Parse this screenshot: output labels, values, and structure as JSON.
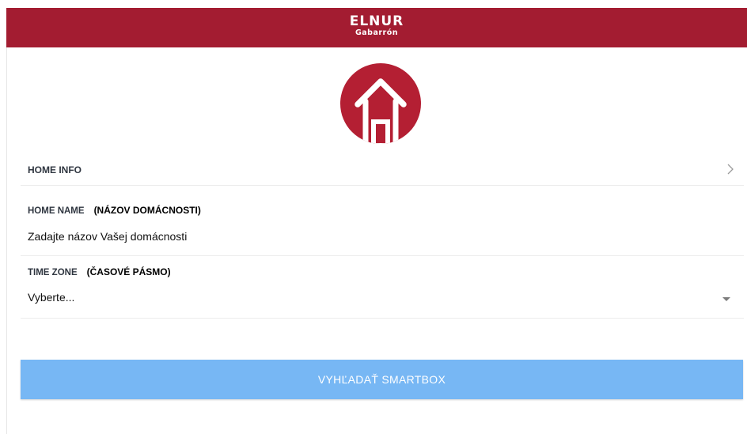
{
  "header": {
    "brand_top": "ELNUR",
    "brand_bottom": "Gabarrón",
    "color": "#a31c31"
  },
  "avatar": {
    "icon": "house-icon",
    "color": "#b41f33"
  },
  "home_info": {
    "title": "HOME INFO",
    "icon": "chevron-right-icon"
  },
  "home_name": {
    "label": "HOME NAME",
    "label_sub": "(NÁZOV DOMÁCNOSTI)",
    "placeholder": "Zadajte názov Vašej domácnosti",
    "value": ""
  },
  "time_zone": {
    "label": "TIME ZONE",
    "label_sub": "(ČASOVÉ PÁSMO)",
    "selected": "Vyberte...",
    "icon": "caret-down-icon"
  },
  "search_button": {
    "label": "VYHĽADAŤ SMARTBOX",
    "color": "#77b7f4"
  }
}
